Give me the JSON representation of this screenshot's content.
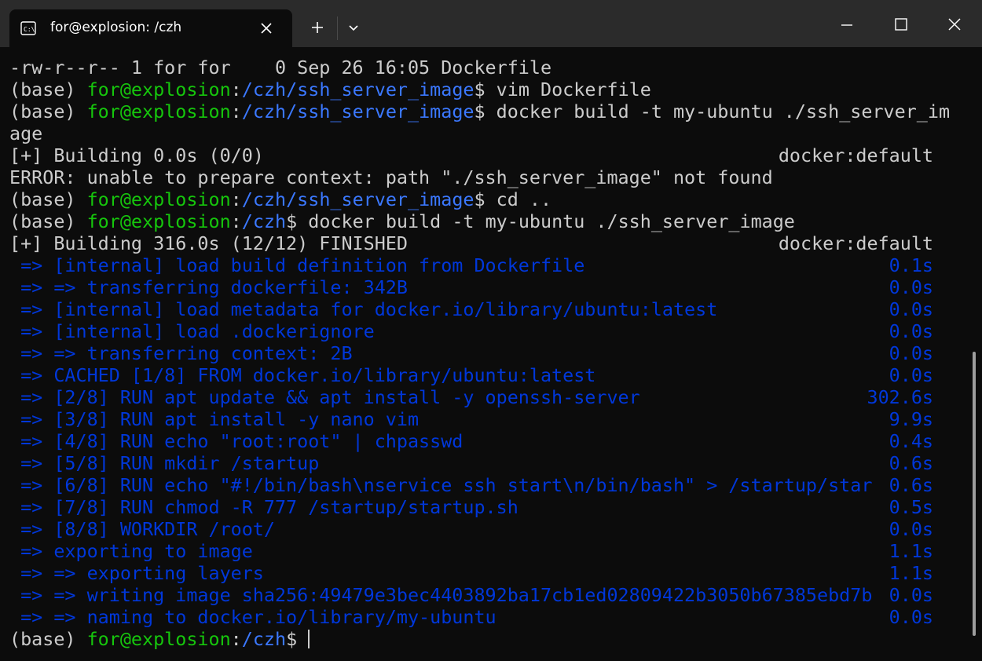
{
  "colors": {
    "background": "#0c0c0c",
    "titlebar": "#2b2b2b",
    "text": "#cccccc",
    "prompt_user": "#16c60c",
    "prompt_path": "#3b78ff",
    "build_steps": "#0037da"
  },
  "tab": {
    "icon": "terminal-icon",
    "title": "for@explosion: /czh",
    "close_icon": "close-icon"
  },
  "titlebar": {
    "new_tab_icon": "plus-icon",
    "dropdown_icon": "chevron-down-icon",
    "minimize_icon": "minimize-icon",
    "maximize_icon": "maximize-icon",
    "close_icon": "close-icon"
  },
  "terminal": {
    "prompt_env": "(base) ",
    "prompt_user": "for@explosion",
    "prompt_colon": ":",
    "prompt_dollar": "$",
    "lines": [
      {
        "type": "plain",
        "text": "-rw-r--r-- 1 for for    0 Sep 26 16:05 Dockerfile"
      },
      {
        "type": "prompt",
        "path": "/czh/ssh_server_image",
        "cmd": " vim Dockerfile"
      },
      {
        "type": "prompt",
        "path": "/czh/ssh_server_image",
        "cmd": " docker build -t my-ubuntu ./ssh_server_im"
      },
      {
        "type": "plain",
        "text": "age"
      },
      {
        "type": "status",
        "text": "[+] Building 0.0s (0/0)",
        "right": "docker:default"
      },
      {
        "type": "plain",
        "text": "ERROR: unable to prepare context: path \"./ssh_server_image\" not found"
      },
      {
        "type": "prompt",
        "path": "/czh/ssh_server_image",
        "cmd": " cd .."
      },
      {
        "type": "prompt",
        "path": "/czh",
        "cmd": " docker build -t my-ubuntu ./ssh_server_image"
      },
      {
        "type": "status",
        "text": "[+] Building 316.0s (12/12) FINISHED",
        "right": "docker:default"
      },
      {
        "type": "step",
        "text": " => [internal] load build definition from Dockerfile",
        "time": "0.1s"
      },
      {
        "type": "step",
        "text": " => => transferring dockerfile: 342B",
        "time": "0.0s"
      },
      {
        "type": "step",
        "text": " => [internal] load metadata for docker.io/library/ubuntu:latest",
        "time": "0.0s"
      },
      {
        "type": "step",
        "text": " => [internal] load .dockerignore",
        "time": "0.0s"
      },
      {
        "type": "step",
        "text": " => => transferring context: 2B",
        "time": "0.0s"
      },
      {
        "type": "step",
        "text": " => CACHED [1/8] FROM docker.io/library/ubuntu:latest",
        "time": "0.0s"
      },
      {
        "type": "step",
        "text": " => [2/8] RUN apt update && apt install -y openssh-server",
        "time": "302.6s"
      },
      {
        "type": "step",
        "text": " => [3/8] RUN apt install -y nano vim",
        "time": "9.9s"
      },
      {
        "type": "step",
        "text": " => [4/8] RUN echo \"root:root\" | chpasswd",
        "time": "0.4s"
      },
      {
        "type": "step",
        "text": " => [5/8] RUN mkdir /startup",
        "time": "0.6s"
      },
      {
        "type": "step",
        "text": " => [6/8] RUN echo \"#!/bin/bash\\nservice ssh start\\n/bin/bash\" > /startup/star",
        "time": "0.6s"
      },
      {
        "type": "step",
        "text": " => [7/8] RUN chmod -R 777 /startup/startup.sh",
        "time": "0.5s"
      },
      {
        "type": "step",
        "text": " => [8/8] WORKDIR /root/",
        "time": "0.0s"
      },
      {
        "type": "step",
        "text": " => exporting to image",
        "time": "1.1s"
      },
      {
        "type": "step",
        "text": " => => exporting layers",
        "time": "1.1s"
      },
      {
        "type": "step",
        "text": " => => writing image sha256:49479e3bec4403892ba17cb1ed02809422b3050b67385ebd7b",
        "time": "0.0s"
      },
      {
        "type": "step",
        "text": " => => naming to docker.io/library/my-ubuntu",
        "time": "0.0s"
      },
      {
        "type": "prompt",
        "path": "/czh",
        "cmd": " ",
        "cursor": true
      }
    ]
  }
}
